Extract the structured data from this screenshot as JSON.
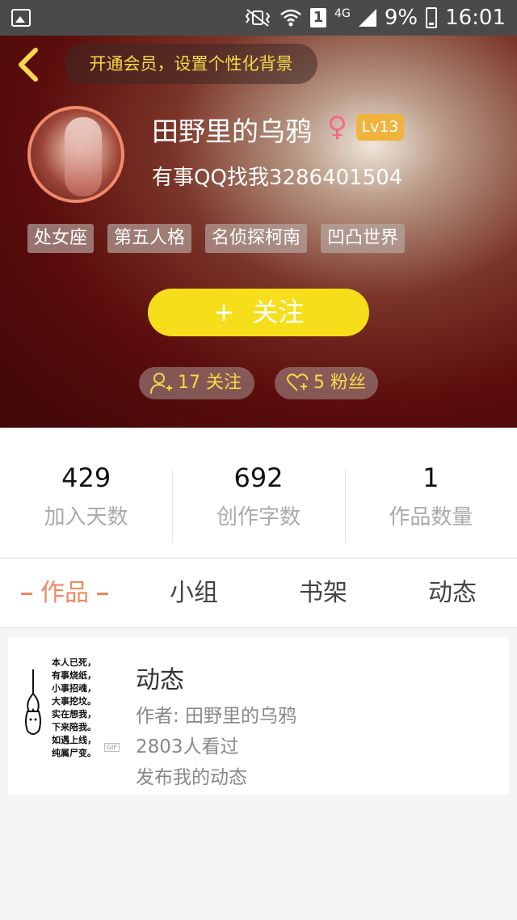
{
  "status_bar": {
    "battery": "9%",
    "time": "16:01",
    "network": "4G",
    "sim": "1",
    "icons": [
      "image-icon",
      "mute-vibrate-icon",
      "wifi-icon",
      "sim-icon",
      "signal-icon",
      "battery-icon"
    ]
  },
  "header": {
    "back_icon": "chevron-left-icon",
    "vip_prompt": "开通会员，设置个性化背景",
    "username": "田野里的乌鸦",
    "gender_symbol": "♀",
    "level": "Lv13",
    "signature": "有事QQ找我3286401504",
    "tags": [
      "处女座",
      "第五人格",
      "名侦探柯南",
      "凹凸世界"
    ],
    "follow_button": {
      "plus": "+",
      "label": "关注"
    },
    "following": "17 关注",
    "fans": "5 粉丝"
  },
  "stats": [
    {
      "value": "429",
      "label": "加入天数"
    },
    {
      "value": "692",
      "label": "创作字数"
    },
    {
      "value": "1",
      "label": "作品数量"
    }
  ],
  "tabs": [
    "作品",
    "小组",
    "书架",
    "动态"
  ],
  "active_tab": "作品",
  "works": [
    {
      "title": "动态",
      "author": "作者: 田野里的乌鸦",
      "views": "2803人看过",
      "description": "发布我的动态",
      "cover_lines": [
        "本人已死，",
        "有事烧纸，",
        "小事招魂，",
        "大事挖坟。",
        "实在想我，",
        "下来陪我。",
        "如遇上线，",
        "纯属尸变。"
      ],
      "cover_badge": "GIF"
    }
  ],
  "colors": {
    "accent": "#f0895f",
    "follow_button": "#f7de1b",
    "vip_text": "#f7d84a",
    "level_badge": "#f1b33e",
    "gender": "#f06b8c"
  }
}
